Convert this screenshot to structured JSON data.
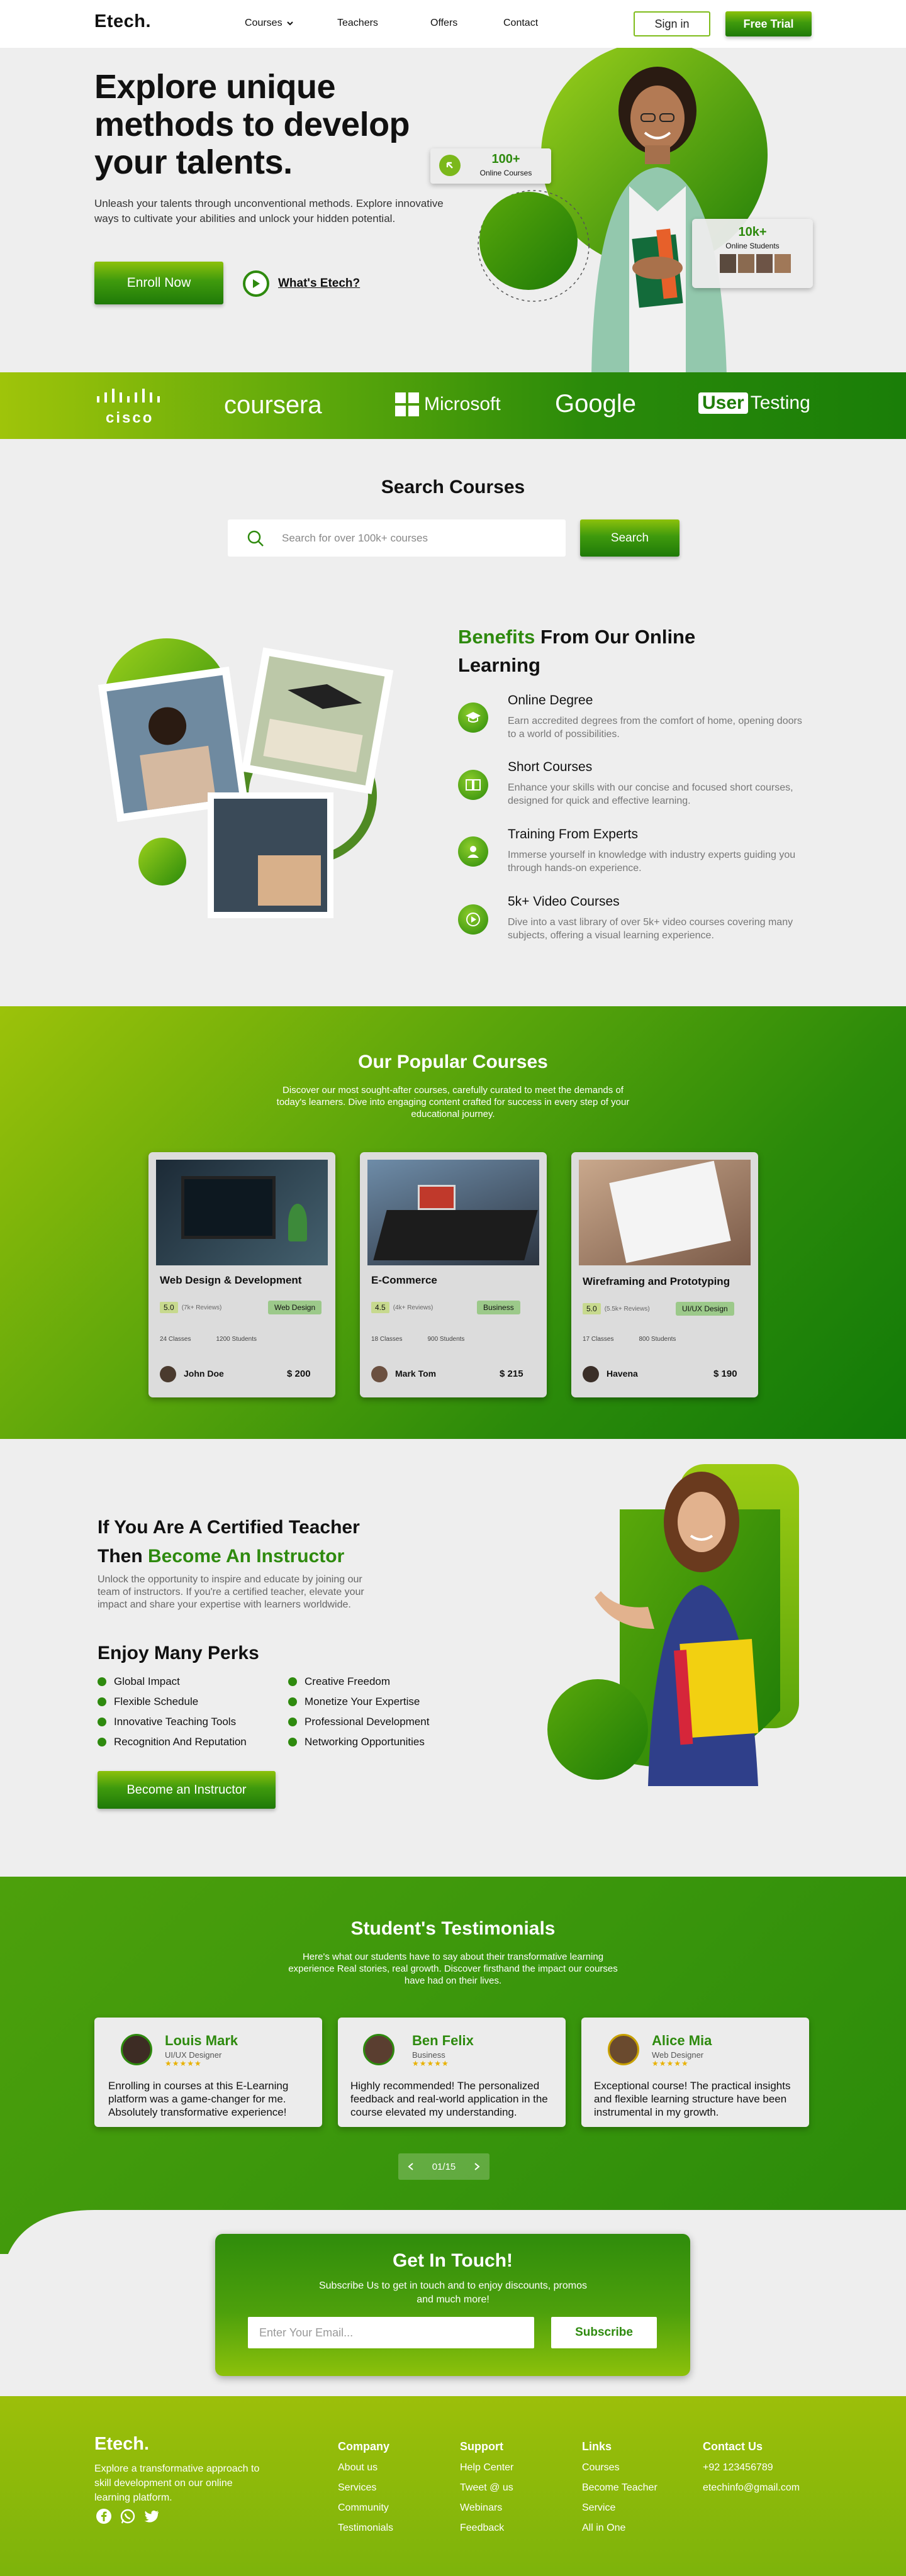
{
  "nav": {
    "logo": "Etech.",
    "links": [
      "Courses",
      "Teachers",
      "Offers",
      "Contact"
    ],
    "signin": "Sign in",
    "trial": "Free Trial"
  },
  "hero": {
    "title_lines": [
      "Explore unique",
      "methods to develop",
      "your talents."
    ],
    "desc": "Unleash your talents through unconventional methods. Explore innovative ways to cultivate your abilities and unlock your hidden potential.",
    "enroll": "Enroll Now",
    "whats": "What's Etech?",
    "stat1_value": "100+",
    "stat1_label": "Online Courses",
    "stat2_value": "10k+",
    "stat2_label": "Online Students"
  },
  "brands": [
    "cisco",
    "coursera",
    "Microsoft",
    "Google",
    "User",
    "Testing"
  ],
  "search": {
    "title": "Search Courses",
    "placeholder": "Search for over 100k+ courses",
    "button": "Search"
  },
  "benefits": {
    "title_green": "Benefits",
    "title_rest": "From Our Online",
    "title_line2": "Learning",
    "items": [
      {
        "title": "Online Degree",
        "desc": "Earn accredited degrees from the comfort of home, opening doors to a world of possibilities."
      },
      {
        "title": "Short Courses",
        "desc": "Enhance your skills with our concise and focused short courses, designed for quick and effective learning."
      },
      {
        "title": "Training From Experts",
        "desc": "Immerse yourself in knowledge with industry experts guiding you through hands-on experience."
      },
      {
        "title": "5k+ Video Courses",
        "desc": "Dive into a vast library of over 5k+ video courses covering many subjects, offering a visual learning experience."
      }
    ]
  },
  "popular": {
    "title": "Our Popular Courses",
    "desc": "Discover our most sought-after courses, carefully curated to meet the demands of today's learners. Dive into engaging content crafted for success in every step of your educational journey.",
    "courses": [
      {
        "title": "Web Design & Development",
        "rating": "5.0",
        "reviews": "(7k+ Reviews)",
        "tag": "Web Design",
        "classes": "24 Classes",
        "students": "1200 Students",
        "author": "John Doe",
        "price": "$ 200"
      },
      {
        "title": "E-Commerce",
        "rating": "4.5",
        "reviews": "(4k+ Reviews)",
        "tag": "Business",
        "classes": "18 Classes",
        "students": "900 Students",
        "author": "Mark Tom",
        "price": "$ 215"
      },
      {
        "title": "Wireframing and Prototyping",
        "rating": "5.0",
        "reviews": "(5.5k+ Reviews)",
        "tag": "UI/UX Design",
        "classes": "17 Classes",
        "students": "800 Students",
        "author": "Havena",
        "price": "$ 190"
      }
    ]
  },
  "instructor": {
    "title_line1": "If You Are A Certified Teacher",
    "title_then": "Then",
    "title_green": "Become An Instructor",
    "desc": "Unlock the opportunity to inspire and educate by joining our team of instructors. If you're a certified teacher, elevate your impact and share your expertise with learners worldwide.",
    "perks_title": "Enjoy Many Perks",
    "perks_left": [
      "Global Impact",
      "Flexible Schedule",
      "Innovative Teaching Tools",
      "Recognition And Reputation"
    ],
    "perks_right": [
      "Creative Freedom",
      "Monetize Your Expertise",
      "Professional Development",
      "Networking Opportunities"
    ],
    "button": "Become an Instructor"
  },
  "testimonials": {
    "title": "Student's Testimonials",
    "desc": "Here's what our students have to say about their transformative learning experience Real stories, real growth. Discover firsthand the impact our courses have had on their lives.",
    "items": [
      {
        "name": "Louis Mark",
        "role": "UI/UX Designer",
        "text": "Enrolling in courses at this E-Learning platform was a game-changer for me. Absolutely transformative experience!"
      },
      {
        "name": "Ben Felix",
        "role": "Business",
        "text": "Highly recommended! The personalized feedback and real-world application in the course elevated my understanding."
      },
      {
        "name": "Alice Mia",
        "role": "Web Designer",
        "text": "Exceptional course! The practical insights and flexible learning structure have been instrumental in my growth."
      }
    ],
    "pager": "01/15"
  },
  "contact": {
    "title": "Get In Touch!",
    "desc": "Subscribe Us to get in touch and to enjoy discounts, promos and much more!",
    "placeholder": "Enter Your Email...",
    "button": "Subscribe"
  },
  "footer": {
    "logo": "Etech.",
    "tagline": "Explore a transformative approach to skill development on our online learning platform.",
    "columns": [
      {
        "head": "Company",
        "links": [
          "About us",
          "Services",
          "Community",
          "Testimonials"
        ]
      },
      {
        "head": "Support",
        "links": [
          "Help Center",
          "Tweet @ us",
          "Webinars",
          "Feedback"
        ]
      },
      {
        "head": "Links",
        "links": [
          "Courses",
          "Become Teacher",
          "Service",
          "All in One"
        ]
      },
      {
        "head": "Contact Us",
        "links": [
          "+92 123456789",
          "etechinfo@gmail.com"
        ]
      }
    ]
  }
}
